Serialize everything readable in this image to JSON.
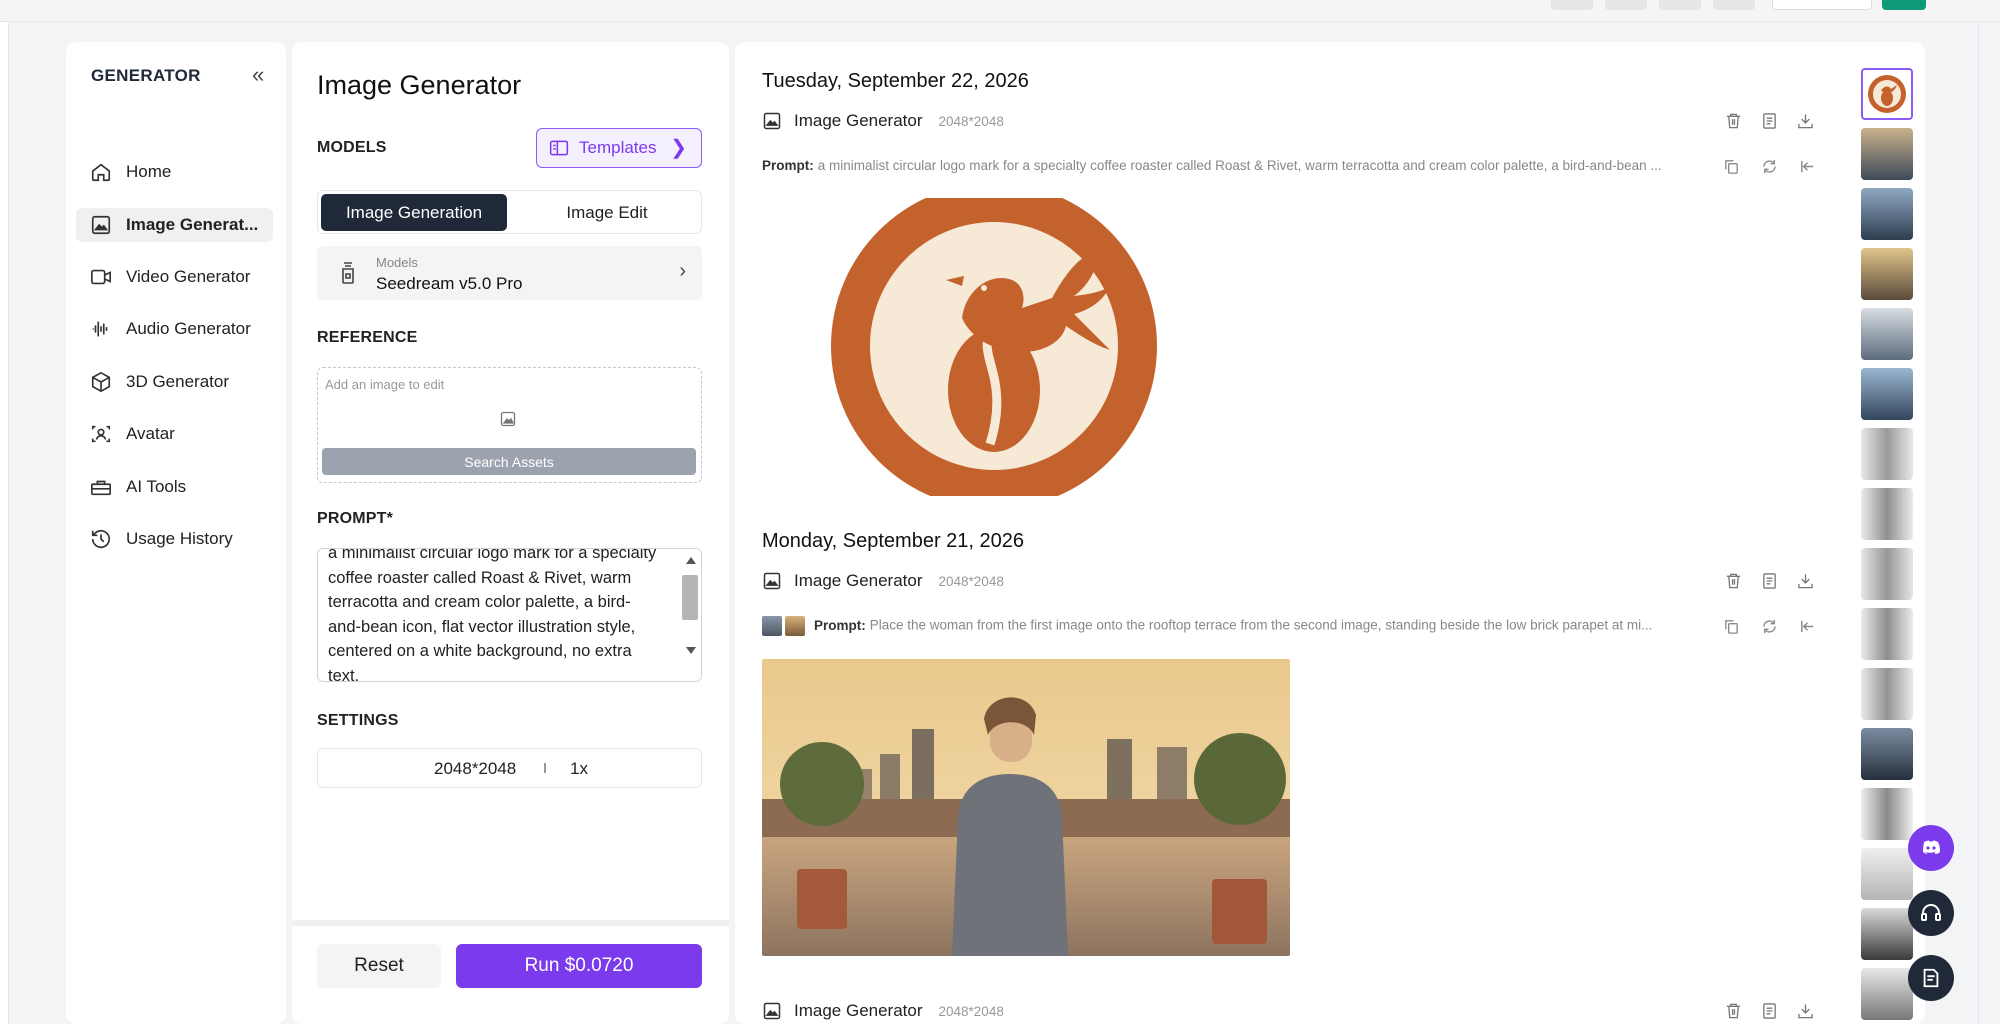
{
  "sidebar": {
    "title": "GENERATOR",
    "items": [
      {
        "label": "Home",
        "icon": "home-icon"
      },
      {
        "label": "Image Generat...",
        "icon": "image-icon"
      },
      {
        "label": "Video Generator",
        "icon": "video-icon"
      },
      {
        "label": "Audio Generator",
        "icon": "audio-wave-icon"
      },
      {
        "label": "3D Generator",
        "icon": "cube-icon"
      },
      {
        "label": "Avatar",
        "icon": "avatar-scan-icon"
      },
      {
        "label": "AI Tools",
        "icon": "toolbox-icon"
      },
      {
        "label": "Usage History",
        "icon": "history-icon"
      }
    ]
  },
  "form": {
    "title": "Image Generator",
    "models_label": "MODELS",
    "templates_label": "Templates",
    "tabs": [
      "Image Generation",
      "Image Edit"
    ],
    "model_caption": "Models",
    "model_value": "Seedream v5.0 Pro",
    "reference_label": "REFERENCE",
    "reference_placeholder": "Add an image to edit",
    "search_assets": "Search Assets",
    "prompt_label": "PROMPT*",
    "prompt_text": "a minimalist circular logo mark for a specialty\ncoffee roaster called Roast & Rivet, warm\nterracotta and cream color palette, a bird-\nand-bean icon, flat vector illustration style,\ncentered on a white background, no extra\ntext.",
    "settings_label": "SETTINGS",
    "settings_size": "2048*2048",
    "settings_count": "1x",
    "reset_label": "Reset",
    "run_label": "Run $0.0720"
  },
  "feed": [
    {
      "date": "Tuesday, September 22, 2026",
      "generator": "Image Generator",
      "size": "2048*2048",
      "prompt_label": "Prompt:",
      "prompt": "a minimalist circular logo mark for a specialty coffee roaster called Roast & Rivet, warm terracotta and cream color palette, a bird-and-bean ..."
    },
    {
      "date": "Monday, September 21, 2026",
      "generator": "Image Generator",
      "size": "2048*2048",
      "prompt_label": "Prompt:",
      "prompt": "Place the woman from the first image onto the rooftop terrace from the second image, standing beside the low brick parapet at mi..."
    },
    {
      "generator": "Image Generator",
      "size": "2048*2048"
    }
  ],
  "colors": {
    "accent": "#7c3aed",
    "dark": "#1f2937",
    "terracotta": "#c4622d",
    "cream": "#f6ead7"
  }
}
